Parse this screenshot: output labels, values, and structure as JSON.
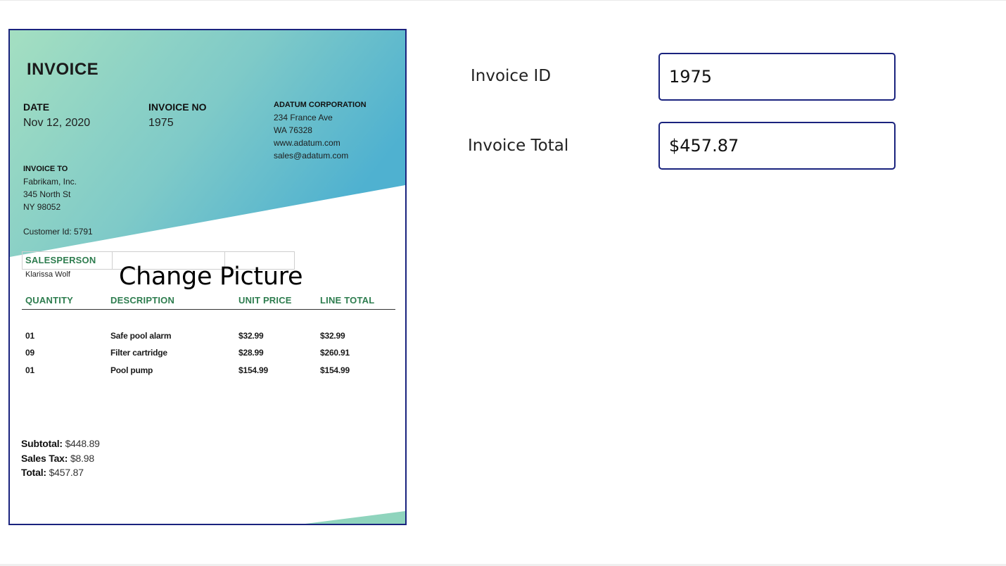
{
  "invoice_image": {
    "title": "INVOICE",
    "date_label": "DATE",
    "date_value": "Nov 12, 2020",
    "invoice_no_label": "INVOICE NO",
    "invoice_no_value": "1975",
    "company": {
      "name": "ADATUM CORPORATION",
      "address": "234 France Ave",
      "city": "WA 76328",
      "website": "www.adatum.com",
      "email": "sales@adatum.com"
    },
    "invoice_to_label": "INVOICE TO",
    "invoice_to": {
      "name": "Fabrikam, Inc.",
      "address": "345 North St",
      "city": "NY 98052"
    },
    "customer_id": "Customer Id: 5791",
    "salesperson_label": "SALESPERSON",
    "salesperson_value": "Klarissa Wolf",
    "columns": [
      "QUANTITY",
      "DESCRIPTION",
      "UNIT PRICE",
      "LINE TOTAL"
    ],
    "rows": [
      {
        "qty": "01",
        "desc": "Safe pool alarm",
        "unit": "$32.99",
        "total": "$32.99"
      },
      {
        "qty": "09",
        "desc": "Filter cartridge",
        "unit": "$28.99",
        "total": "$260.91"
      },
      {
        "qty": "01",
        "desc": "Pool pump",
        "unit": "$154.99",
        "total": "$154.99"
      }
    ],
    "subtotal_label": "Subtotal:",
    "subtotal_value": "$448.89",
    "tax_label": "Sales Tax:",
    "tax_value": "$8.98",
    "total_label": "Total:",
    "total_value": "$457.87",
    "gradient_colors": [
      "#9ddcbf",
      "#56b4d0"
    ],
    "accent_green": "#2e7d4f"
  },
  "change_picture_label": "Change Picture",
  "form": {
    "invoice_id": {
      "label": "Invoice ID",
      "value": "1975"
    },
    "invoice_total": {
      "label": "Invoice Total",
      "value": "$457.87"
    }
  },
  "colors": {
    "border": "#1a237e"
  }
}
